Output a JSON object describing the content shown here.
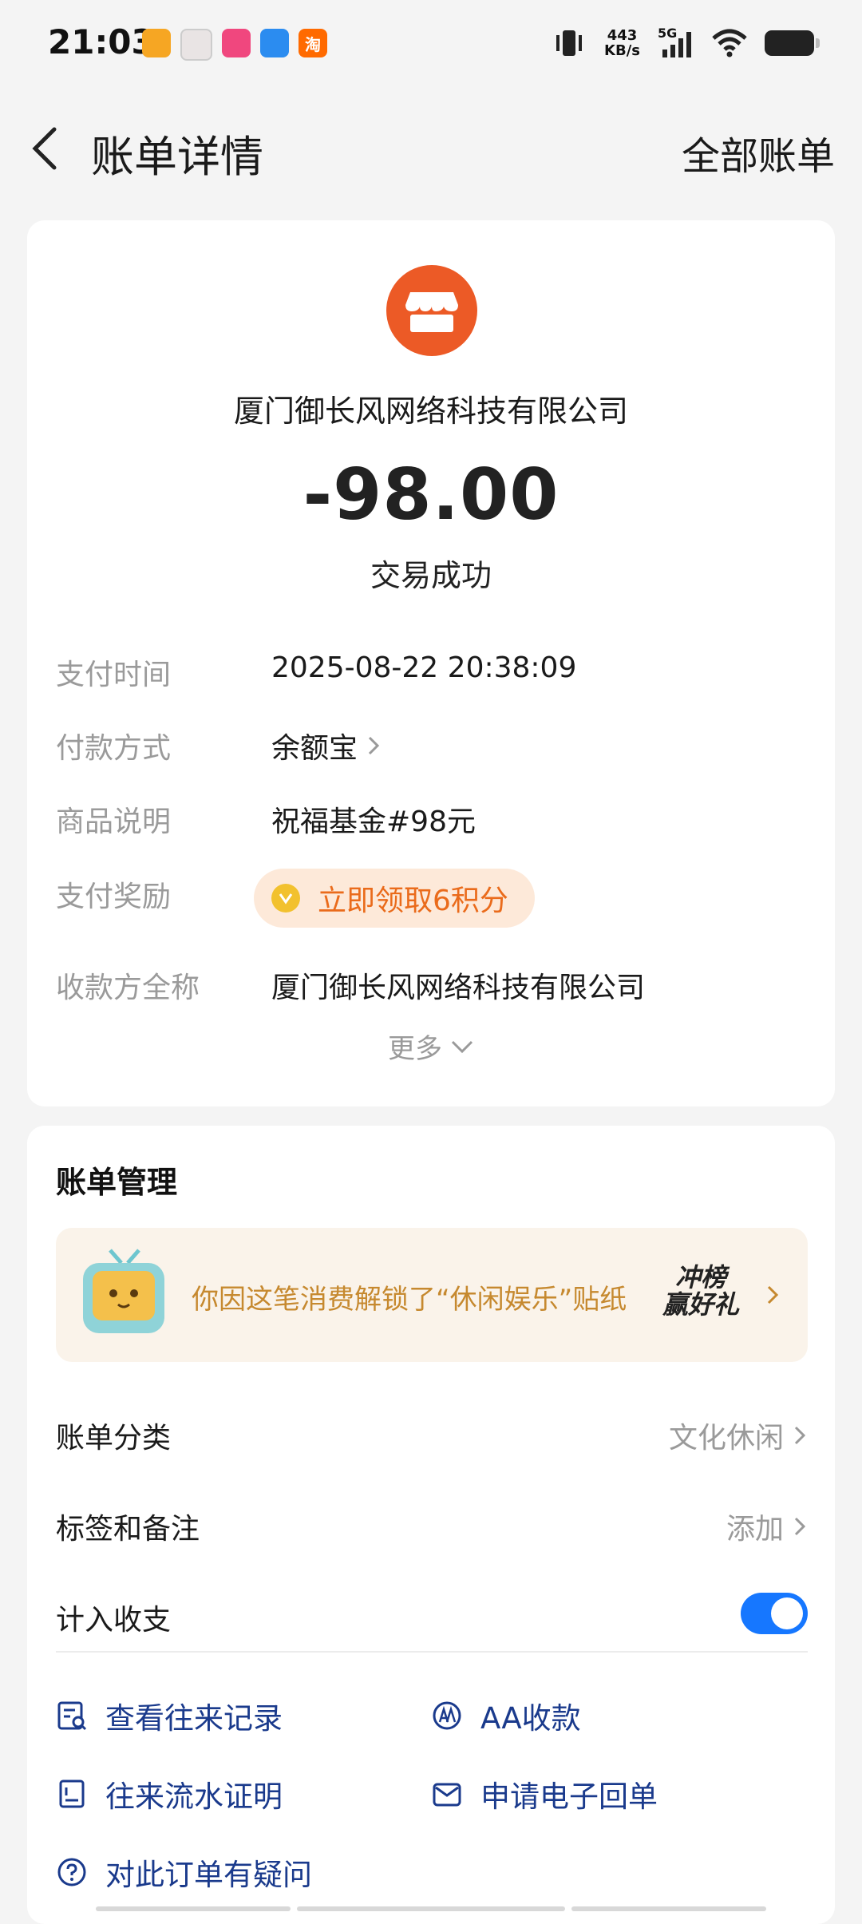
{
  "status_bar": {
    "time": "21:03",
    "net_speed_value": "443",
    "net_speed_unit": "KB/s",
    "network": "5G",
    "app_icons": [
      "app-icon-1",
      "app-icon-2",
      "app-icon-3",
      "app-icon-4",
      "taobao-icon"
    ],
    "taobao_glyph": "淘"
  },
  "header": {
    "title": "账单详情",
    "right_link": "全部账单"
  },
  "bill": {
    "merchant": "厦门御长风网络科技有限公司",
    "amount": "-98.00",
    "status": "交易成功",
    "rows": [
      {
        "label": "支付时间",
        "value": "2025-08-22 20:38:09"
      },
      {
        "label": "付款方式",
        "value": "余额宝"
      },
      {
        "label": "商品说明",
        "value": "祝福基金#98元"
      },
      {
        "label": "支付奖励",
        "value": "立即领取6积分"
      },
      {
        "label": "收款方全称",
        "value": "厦门御长风网络科技有限公司"
      }
    ],
    "more": "更多"
  },
  "management": {
    "title": "账单管理",
    "sticker_text": "你因这笔消费解锁了“休闲娱乐”贴纸",
    "promo_badge_line1": "冲榜",
    "promo_badge_line2": "赢好礼",
    "category_label": "账单分类",
    "category_value": "文化休闲",
    "tags_label": "标签和备注",
    "tags_value": "添加",
    "include_label": "计入收支",
    "include_on": true,
    "actions": {
      "history": "查看往来记录",
      "aa": "AA收款",
      "proof": "往来流水证明",
      "receipt": "申请电子回单",
      "question": "对此订单有疑问"
    }
  },
  "colors": {
    "accent_blue": "#1677ff",
    "merchant_orange": "#ec5a26",
    "reward_orange": "#ea6b1b",
    "action_blue": "#1a3a8c"
  }
}
